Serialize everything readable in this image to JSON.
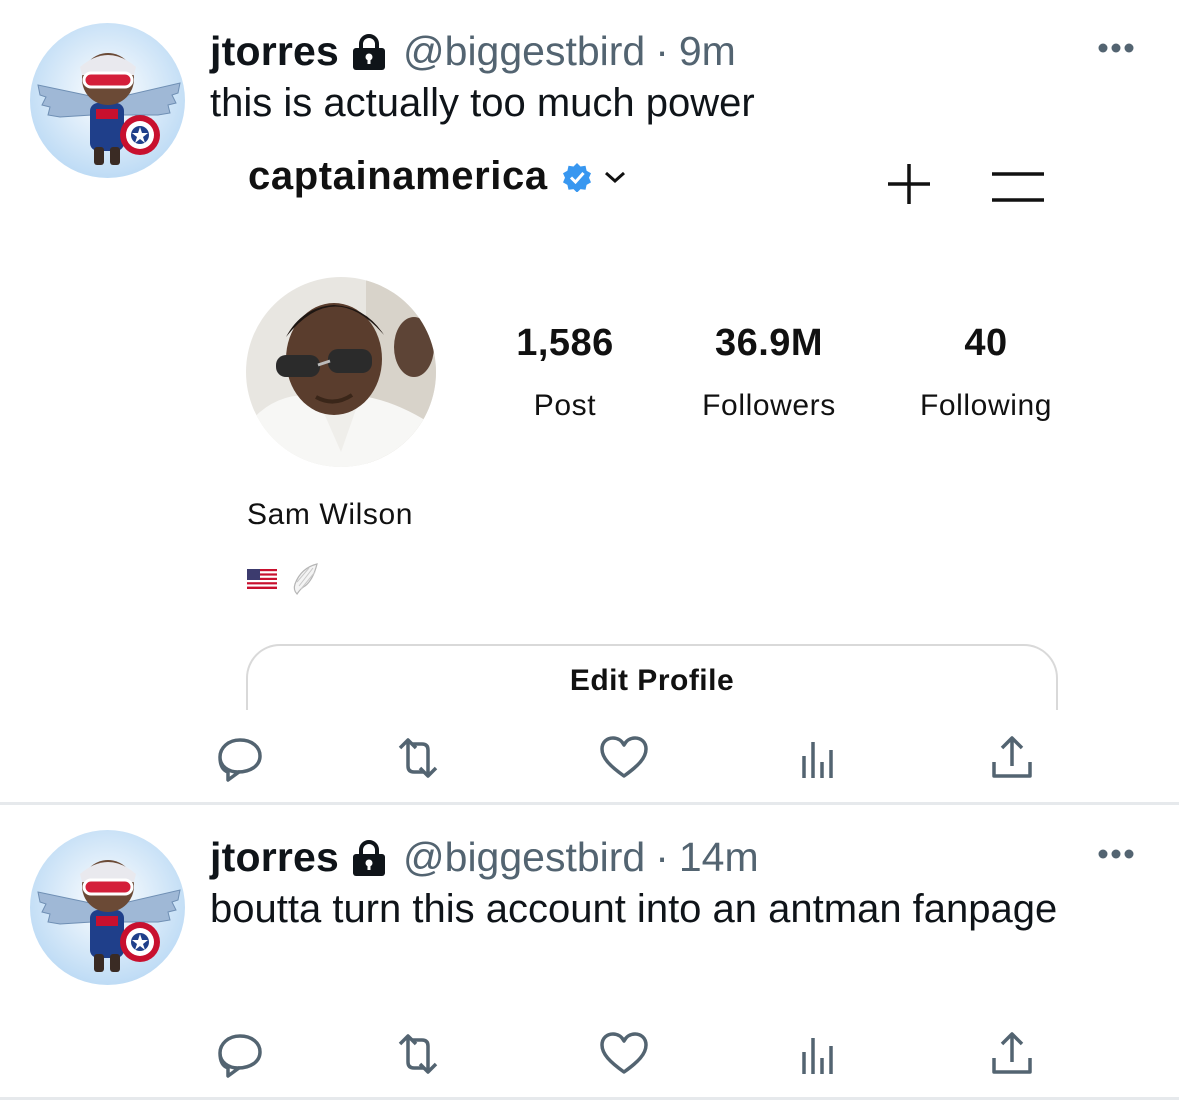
{
  "tweets": [
    {
      "display_name": "jtorres",
      "handle": "@biggestbird",
      "separator": "·",
      "time": "9m",
      "text": "this is actually too much power",
      "embedded_profile": {
        "username": "captainamerica",
        "stats": [
          {
            "value": "1,586",
            "label": "Post"
          },
          {
            "value": "36.9M",
            "label": "Followers"
          },
          {
            "value": "40",
            "label": "Following"
          }
        ],
        "full_name": "Sam Wilson",
        "bio_icons": [
          "us-flag-icon",
          "wing-icon"
        ],
        "edit_button": "Edit Profile"
      }
    },
    {
      "display_name": "jtorres",
      "handle": "@biggestbird",
      "separator": "·",
      "time": "14m",
      "text": "boutta turn this account into an antman fanpage"
    }
  ],
  "actions": [
    "reply-icon",
    "retweet-icon",
    "like-icon",
    "stats-icon",
    "share-icon"
  ],
  "colors": {
    "text": "#0f1419",
    "secondary": "#536471",
    "icon": "#536471",
    "verified": "#3897f0",
    "divider": "#e6e9ec"
  }
}
